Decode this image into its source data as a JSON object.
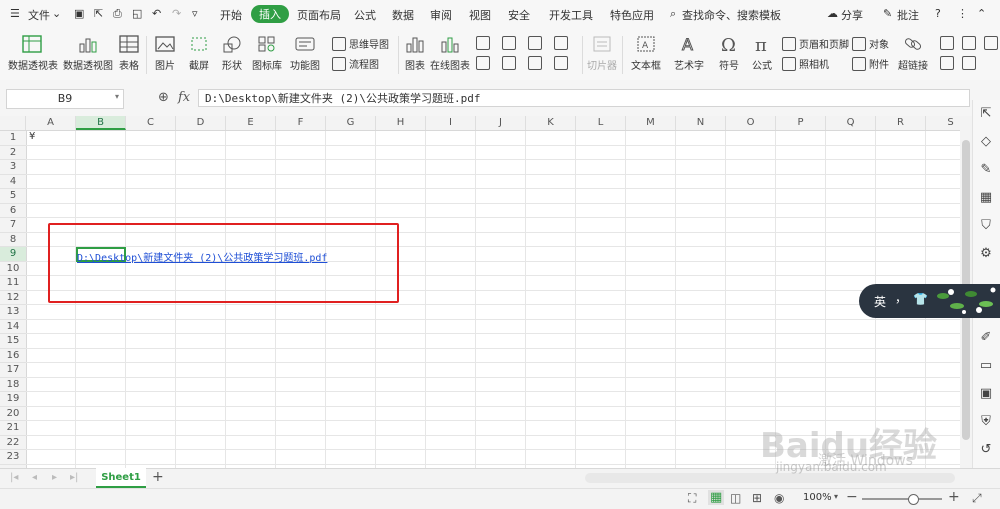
{
  "menubar": {
    "file_menu": "文件",
    "tabs": [
      "开始",
      "插入",
      "页面布局",
      "公式",
      "数据",
      "审阅",
      "视图",
      "安全",
      "开发工具",
      "特色应用"
    ],
    "active_tab": "插入",
    "search": "查找命令、搜索模板",
    "share": "分享",
    "annotate": "批注"
  },
  "ribbon": {
    "big": [
      "数据透视表",
      "数据透视图",
      "表格",
      "图片",
      "截屏",
      "形状",
      "图标库",
      "功能图",
      "图表",
      "在线图表",
      "切片器",
      "文本框",
      "艺术字",
      "符号",
      "公式"
    ],
    "small": {
      "mindmap": "思维导图",
      "flowchart": "流程图",
      "header_footer": "页眉和页脚",
      "camera": "照相机",
      "object": "对象",
      "attachment": "附件",
      "hyperlink": "超链接"
    }
  },
  "formula_bar": {
    "name_box": "B9",
    "fx": "fx",
    "content": "D:\\Desktop\\新建文件夹 (2)\\公共政策学习题班.pdf"
  },
  "grid": {
    "columns": [
      "A",
      "B",
      "C",
      "D",
      "E",
      "F",
      "G",
      "H",
      "I",
      "J",
      "K",
      "L",
      "M",
      "N",
      "O",
      "P",
      "Q",
      "R",
      "S"
    ],
    "rows": [
      "1",
      "2",
      "3",
      "4",
      "5",
      "6",
      "7",
      "8",
      "9",
      "10",
      "11",
      "12",
      "13",
      "14",
      "15",
      "16",
      "17",
      "18",
      "19",
      "20",
      "21",
      "22",
      "23"
    ],
    "selected_column": "B",
    "selected_row": "9",
    "a1_value": "¥",
    "link_text": "D:\\Desktop\\新建文件夹 (2)\\公共政策学习题班.pdf"
  },
  "sheet": {
    "tab": "Sheet1",
    "add": "+"
  },
  "status": {
    "zoom": "100%",
    "minus": "−",
    "plus": "+"
  },
  "ime": {
    "lang": "英",
    "punct": "，"
  },
  "watermarks": {
    "activate": "激活 Windows",
    "baidu": "Baidu经验",
    "baidu_url": "jingyan.baidu.com"
  },
  "colors": {
    "accent": "#2f9e44",
    "link": "#1f4fd6",
    "highlight_box": "#e02020"
  }
}
